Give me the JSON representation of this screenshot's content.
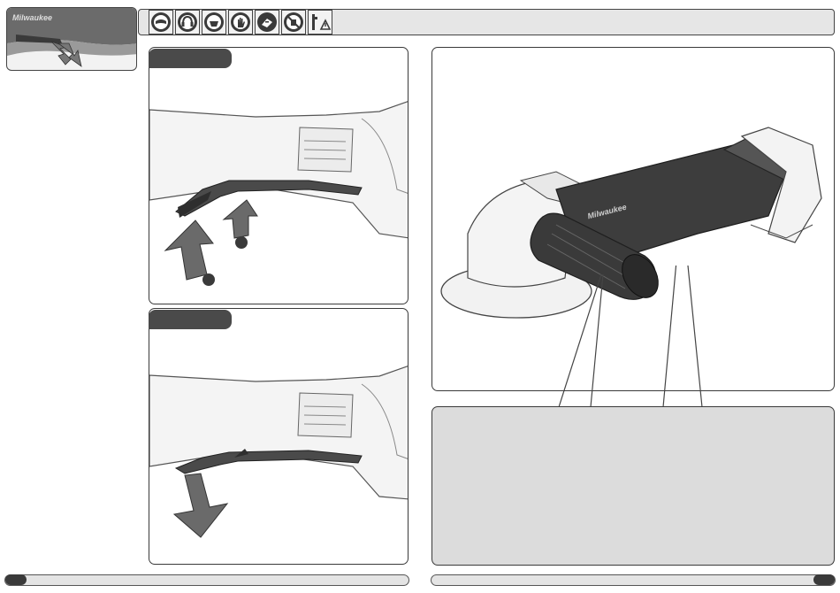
{
  "header": {
    "safety_icons": [
      {
        "name": "eye-protection-icon"
      },
      {
        "name": "ear-protection-icon"
      },
      {
        "name": "dust-mask-icon"
      },
      {
        "name": "gloves-icon"
      },
      {
        "name": "read-manual-icon"
      },
      {
        "name": "no-disposal-icon"
      },
      {
        "name": "warning-icon"
      }
    ],
    "brand_text": "Milwaukee"
  },
  "left": {
    "step_a_label": "",
    "step_b_label": "",
    "callout_1": "",
    "callout_2": ""
  },
  "right": {
    "tool_brand": "Milwaukee",
    "note_text": ""
  },
  "footer": {
    "left_page": "",
    "right_page": ""
  },
  "colors": {
    "frame": "#3a3a3a",
    "tab_fill": "#4a4a4a",
    "arrow_fill": "#6a6a6a",
    "note_fill": "#dcdcdc",
    "header_bar": "#e6e6e6"
  }
}
